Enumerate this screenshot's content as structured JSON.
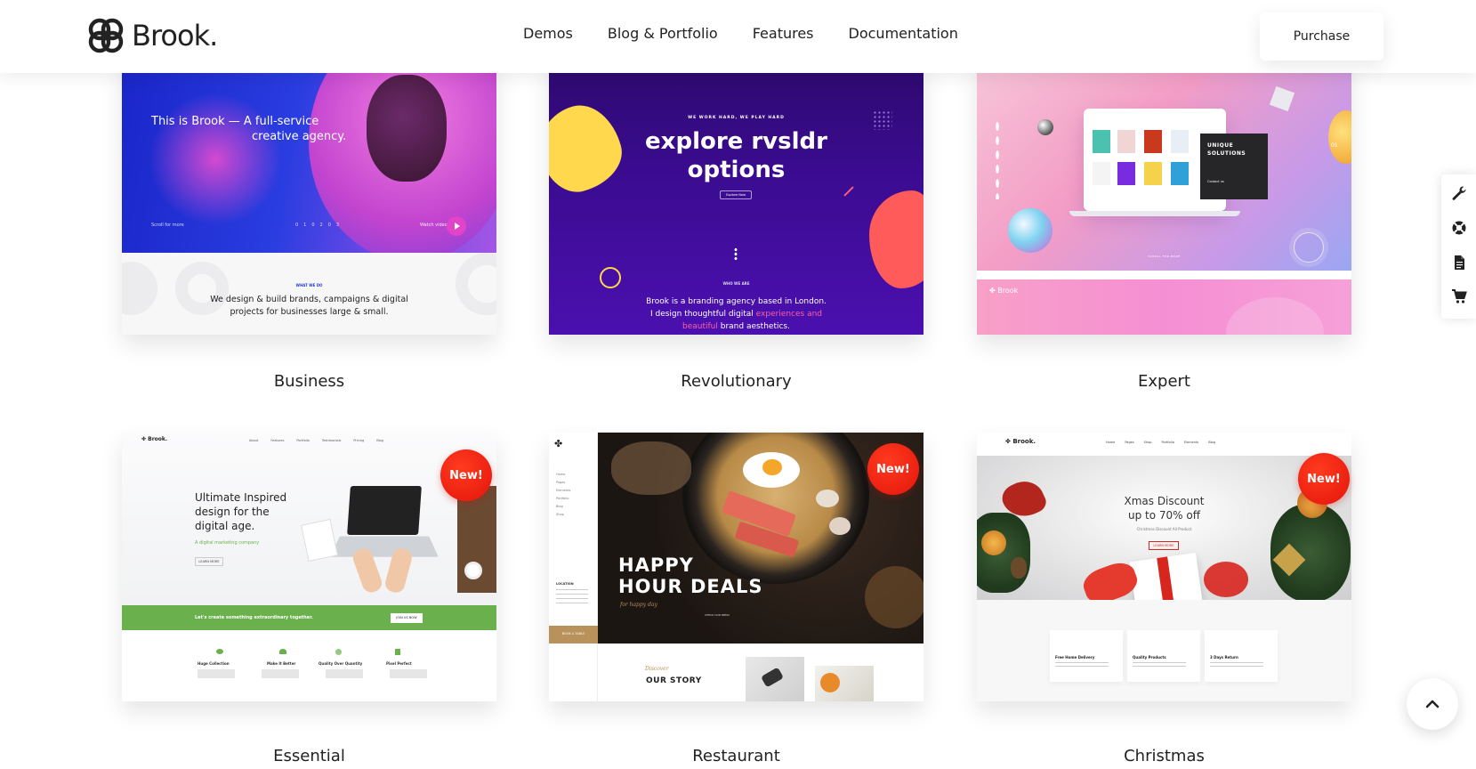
{
  "header": {
    "logo_text": "Brook.",
    "nav": [
      "Demos",
      "Blog & Portfolio",
      "Features",
      "Documentation"
    ],
    "purchase_label": "Purchase"
  },
  "demos": [
    {
      "title": "Business",
      "new": false,
      "preview": {
        "headline_1": "This is Brook —",
        "headline_2": "A full-service",
        "headline_3": "creative agency.",
        "scroll": "Scroll for more",
        "watch": "Watch video",
        "pager": [
          "01",
          "02",
          "03"
        ],
        "eyebrow": "WHAT WE DO",
        "body_1": "We design & build brands, campaigns & digital",
        "body_2": "projects for businesses large & small."
      }
    },
    {
      "title": "Revolutionary",
      "new": false,
      "preview": {
        "eyebrow": "WE WORK HARD, WE PLAY HARD",
        "headline_1": "explore rvsldr",
        "headline_2": "options",
        "button": "Explore Now",
        "who": "WHO WE ARE",
        "body_1": "Brook is a branding agency based in London.",
        "body_2a": "I design thoughtful digital ",
        "body_2b": "experiences and",
        "body_3a": "beautiful",
        "body_3b": " brand aesthetics."
      }
    },
    {
      "title": "Expert",
      "new": false,
      "preview": {
        "card_1": "UNIQUE",
        "card_2": "SOLUTIONS",
        "card_link": "Contact us",
        "counter": "01",
        "scroll": "SCROLL FOR MORE",
        "logo": "Brook"
      }
    },
    {
      "title": "Essential",
      "new": true,
      "new_label": "New!",
      "preview": {
        "logo": "Brook.",
        "menu": [
          "About",
          "Features",
          "Portfolio",
          "Testimonials",
          "Pricing",
          "Blog"
        ],
        "headline_1": "Ultimate Inspired",
        "headline_2": "design for the",
        "headline_3": "digital age.",
        "tagline": "A digital marketing company",
        "button": "LEARN MORE",
        "band_text": "Let's create something extraordinary together.",
        "band_button": "JOIN US NOW",
        "features": [
          "Huge Collection",
          "Make It Better",
          "Quality Over Quantity",
          "Pixel Perfect"
        ]
      }
    },
    {
      "title": "Restaurant",
      "new": true,
      "new_label": "New!",
      "preview": {
        "menu": [
          "Home",
          "Pages",
          "Elements",
          "Portfolio",
          "Blog",
          "Shop"
        ],
        "location": "LOCATION",
        "book": "BOOK A TABLE",
        "headline_1": "HAPPY",
        "headline_2": "HOUR DEALS",
        "script": "for happy day",
        "cta": "CHECK OUR MENU",
        "story_script": "Discover",
        "story": "OUR STORY"
      }
    },
    {
      "title": "Christmas",
      "new": true,
      "new_label": "New!",
      "preview": {
        "logo": "Brook.",
        "menu": [
          "Home",
          "Pages",
          "Shop",
          "Portfolio",
          "Elements",
          "Blog"
        ],
        "headline_1": "Xmas Discount",
        "headline_2": "up to 70% off",
        "sub": "Christmas Discount All Product",
        "button": "LEARN MORE",
        "boxes": [
          "Free Home Delivery",
          "Quality Products",
          "3 Days Return"
        ]
      }
    }
  ],
  "side_tools": [
    "wrench-icon",
    "lifebuoy-icon",
    "document-icon",
    "cart-icon"
  ],
  "colors": {
    "badge": "#e4140b",
    "business_blue": "#1e2fd6",
    "business_pink": "#e041c8",
    "revolutionary_purple": "#3a0b8f",
    "essential_green": "#6ab04c",
    "text": "#222222"
  }
}
